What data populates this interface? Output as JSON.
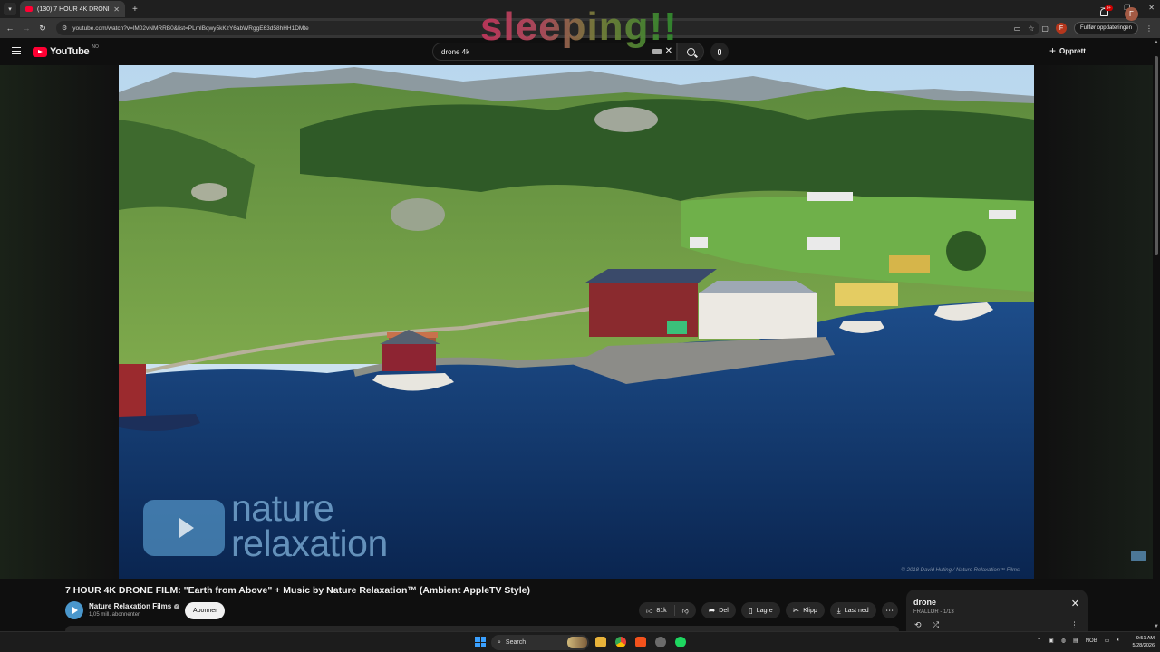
{
  "browser": {
    "tab_title": "(130) 7 HOUR 4K DRONE FILM",
    "url": "youtube.com/watch?v=lM02vNMRRB0&list=PLmlBqwy5kKzY6abWRggE63d58hHH1DMte",
    "update_button": "Fullfør oppdateringen",
    "profile_initial": "F"
  },
  "overlay_text": "sleeping!!",
  "youtube": {
    "logo_text": "YouTube",
    "region": "NO",
    "search_value": "drone 4k",
    "create_label": "Opprett",
    "notifications_badge": "9+",
    "avatar_initial": "F"
  },
  "video": {
    "watermark_line1": "nature",
    "watermark_line2": "relaxation",
    "copyright": "© 2018 David Huting / Nature Relaxation™ Films",
    "title": "7 HOUR 4K DRONE FILM: \"Earth from Above\" + Music by Nature Relaxation™ (Ambient AppleTV Style)",
    "channel_name": "Nature Relaxation Films",
    "subscribers": "1,05 mill. abonnenter",
    "subscribe_label": "Abonner"
  },
  "actions": {
    "likes": "81k",
    "share": "Del",
    "save": "Lagre",
    "clip": "Klipp",
    "download": "Last ned"
  },
  "playlist": {
    "title": "drone",
    "subtitle": "FRALLOR - 1/13"
  },
  "taskbar": {
    "search_label": "Search",
    "language": "NOB",
    "time": "9:51 AM",
    "date": "5/28/2026"
  }
}
